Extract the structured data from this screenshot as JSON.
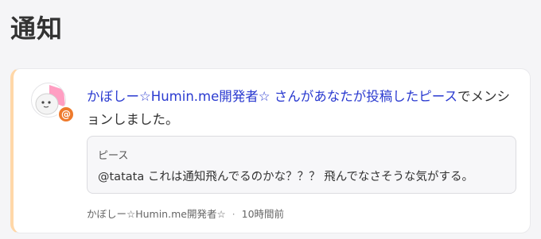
{
  "page": {
    "title": "通知"
  },
  "notification": {
    "actor_name": "かぼしー☆Humin.me開発者☆",
    "message_mid": " さんがあなたが投稿した",
    "target_label": "ピース",
    "message_end": "でメンションしました。",
    "badge_symbol": "@",
    "quote": {
      "title": "ピース",
      "body": "@tatata これは通知飛んでるのかな？？？ 飛んでなさそうな気がする。"
    },
    "meta": {
      "author": "かぼしー☆Humin.me開発者☆",
      "separator": "·",
      "time": "10時間前"
    }
  },
  "colors": {
    "accent_border": "#ffd7a8",
    "link": "#2a3ad0",
    "badge": "#ee7a2c"
  }
}
